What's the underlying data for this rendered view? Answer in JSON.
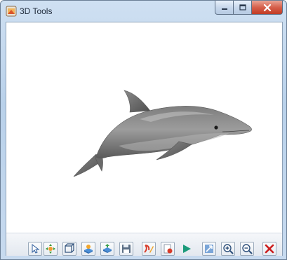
{
  "window": {
    "title": "3D Tools"
  },
  "viewport": {
    "model": "dolphin"
  },
  "toolbar": {
    "buttons": [
      {
        "name": "select-tool",
        "icon": "cursor-arrow-icon"
      },
      {
        "name": "move-tool",
        "icon": "move-arrows-icon"
      },
      {
        "name": "bounding-box-tool",
        "icon": "cube-frame-icon"
      },
      {
        "name": "load-model-tool",
        "icon": "load-model-icon"
      },
      {
        "name": "export-model-tool",
        "icon": "export-model-icon"
      },
      {
        "name": "save-tool",
        "icon": "floppy-disk-icon"
      },
      {
        "name": "edit-tool",
        "icon": "edit-brush-icon"
      },
      {
        "name": "record-tool",
        "icon": "record-icon"
      },
      {
        "name": "play-tool",
        "icon": "play-icon"
      },
      {
        "name": "fit-view-tool",
        "icon": "fit-view-icon"
      },
      {
        "name": "zoom-in-tool",
        "icon": "zoom-in-icon"
      },
      {
        "name": "zoom-out-tool",
        "icon": "zoom-out-icon"
      },
      {
        "name": "close-tool",
        "icon": "close-x-icon"
      }
    ]
  },
  "colors": {
    "accent_red": "#cc2020",
    "play_green": "#1a9a7a",
    "title_bar": "#c7daef"
  }
}
